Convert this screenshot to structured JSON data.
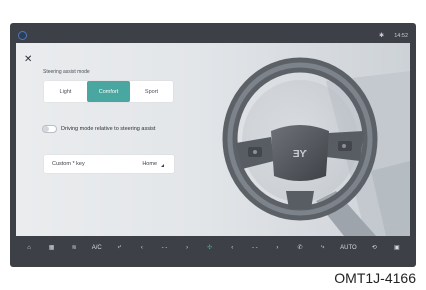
{
  "status": {
    "signal_icon": "bluetooth-icon",
    "time": "14:52"
  },
  "panel": {
    "close_label": "✕",
    "steering_mode_title": "Steering assist mode",
    "modes": [
      "Light",
      "Comfort",
      "Sport"
    ],
    "active_mode": "Comfort",
    "driving_mode_toggle_label": "Driving mode relative to steering assist",
    "driving_mode_toggle_on": false,
    "custom_key_label": "Custom * key",
    "custom_key_value": "Home"
  },
  "dock": {
    "items": [
      {
        "name": "home-icon",
        "glyph": "⌂"
      },
      {
        "name": "apps-icon",
        "glyph": "▦"
      },
      {
        "name": "air-flow-icon",
        "glyph": "≋"
      },
      {
        "name": "ac-label",
        "glyph": "A/C"
      },
      {
        "name": "seat-icon",
        "glyph": "⤶"
      },
      {
        "name": "temp-left-decrease",
        "glyph": "‹"
      },
      {
        "name": "temp-left-value",
        "glyph": "- -"
      },
      {
        "name": "temp-left-increase",
        "glyph": "›"
      },
      {
        "name": "fan-icon",
        "glyph": "✣"
      },
      {
        "name": "temp-right-decrease",
        "glyph": "‹"
      },
      {
        "name": "temp-right-value",
        "glyph": "- -"
      },
      {
        "name": "temp-right-increase",
        "glyph": "›"
      },
      {
        "name": "phone-icon",
        "glyph": "✆"
      },
      {
        "name": "seat-right-icon",
        "glyph": "⤷"
      },
      {
        "name": "auto-label",
        "glyph": "AUTO"
      },
      {
        "name": "recirculation-icon",
        "glyph": "⟲"
      },
      {
        "name": "defrost-icon",
        "glyph": "▣"
      }
    ]
  },
  "caption": "OMT1J-4166"
}
